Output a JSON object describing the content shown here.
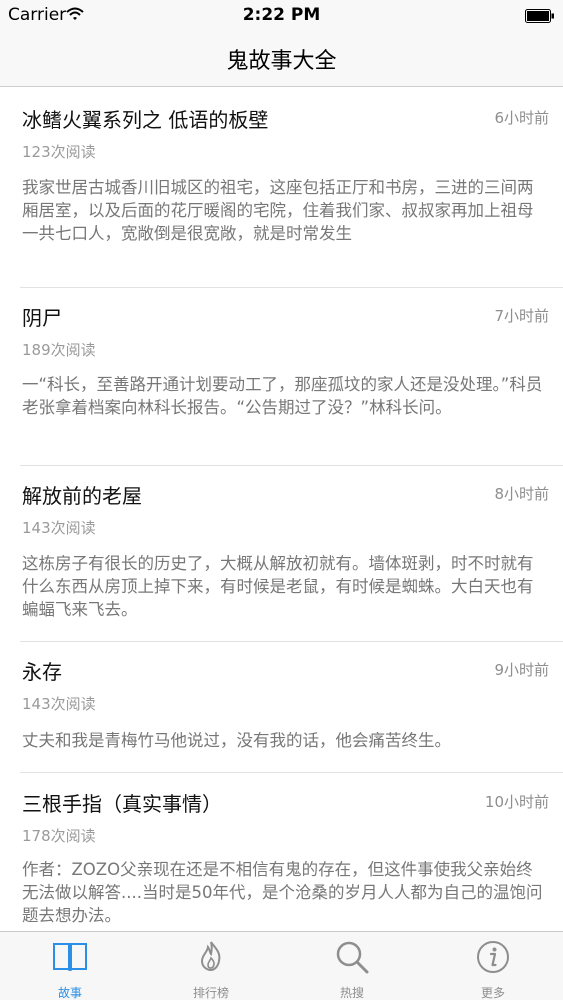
{
  "status_bar": {
    "carrier": "Carrier",
    "time": "2:22 PM"
  },
  "nav": {
    "title": "鬼故事大全"
  },
  "stories": [
    {
      "title": "冰鳍火翼系列之 低语的板壁",
      "time": "6小时前",
      "reads": "123次阅读",
      "summary": "我家世居古城香川旧城区的祖宅，这座包括正厅和书房，三进的三间两厢居室，以及后面的花厅暖阁的宅院，住着我们家、叔叔家再加上祖母一共七口人，宽敞倒是很宽敞，就是时常发生"
    },
    {
      "title": "阴尸",
      "time": "7小时前",
      "reads": "189次阅读",
      "summary": "一“科长，至善路开通计划要动工了，那座孤坟的家人还是没处理。”科员老张拿着档案向林科长报告。“公告期过了没？”林科长问。"
    },
    {
      "title": "解放前的老屋",
      "time": "8小时前",
      "reads": "143次阅读",
      "summary": "这栋房子有很长的历史了，大概从解放初就有。墙体斑剥，时不时就有什么东西从房顶上掉下来，有时候是老鼠，有时候是蜘蛛。大白天也有蝙蝠飞来飞去。"
    },
    {
      "title": "永存",
      "time": "9小时前",
      "reads": "143次阅读",
      "summary": "丈夫和我是青梅竹马他说过，没有我的话，他会痛苦终生。"
    },
    {
      "title": "三根手指（真实事情）",
      "time": "10小时前",
      "reads": "178次阅读",
      "summary": "作者：ZOZO父亲现在还是不相信有鬼的存在，但这件事使我父亲始终无法做以解答....当时是50年代，是个沧桑的岁月人人都为自己的温饱问题去想办法。"
    }
  ],
  "tabs": [
    {
      "label": "故事",
      "icon": "book-icon",
      "active": true
    },
    {
      "label": "排行榜",
      "icon": "flame-icon",
      "active": false
    },
    {
      "label": "热搜",
      "icon": "search-icon",
      "active": false
    },
    {
      "label": "更多",
      "icon": "info-icon",
      "active": false
    }
  ],
  "colors": {
    "accent": "#2a8fe6",
    "inactive": "#8e8e8e",
    "bar_bg": "#f8f8f8"
  }
}
